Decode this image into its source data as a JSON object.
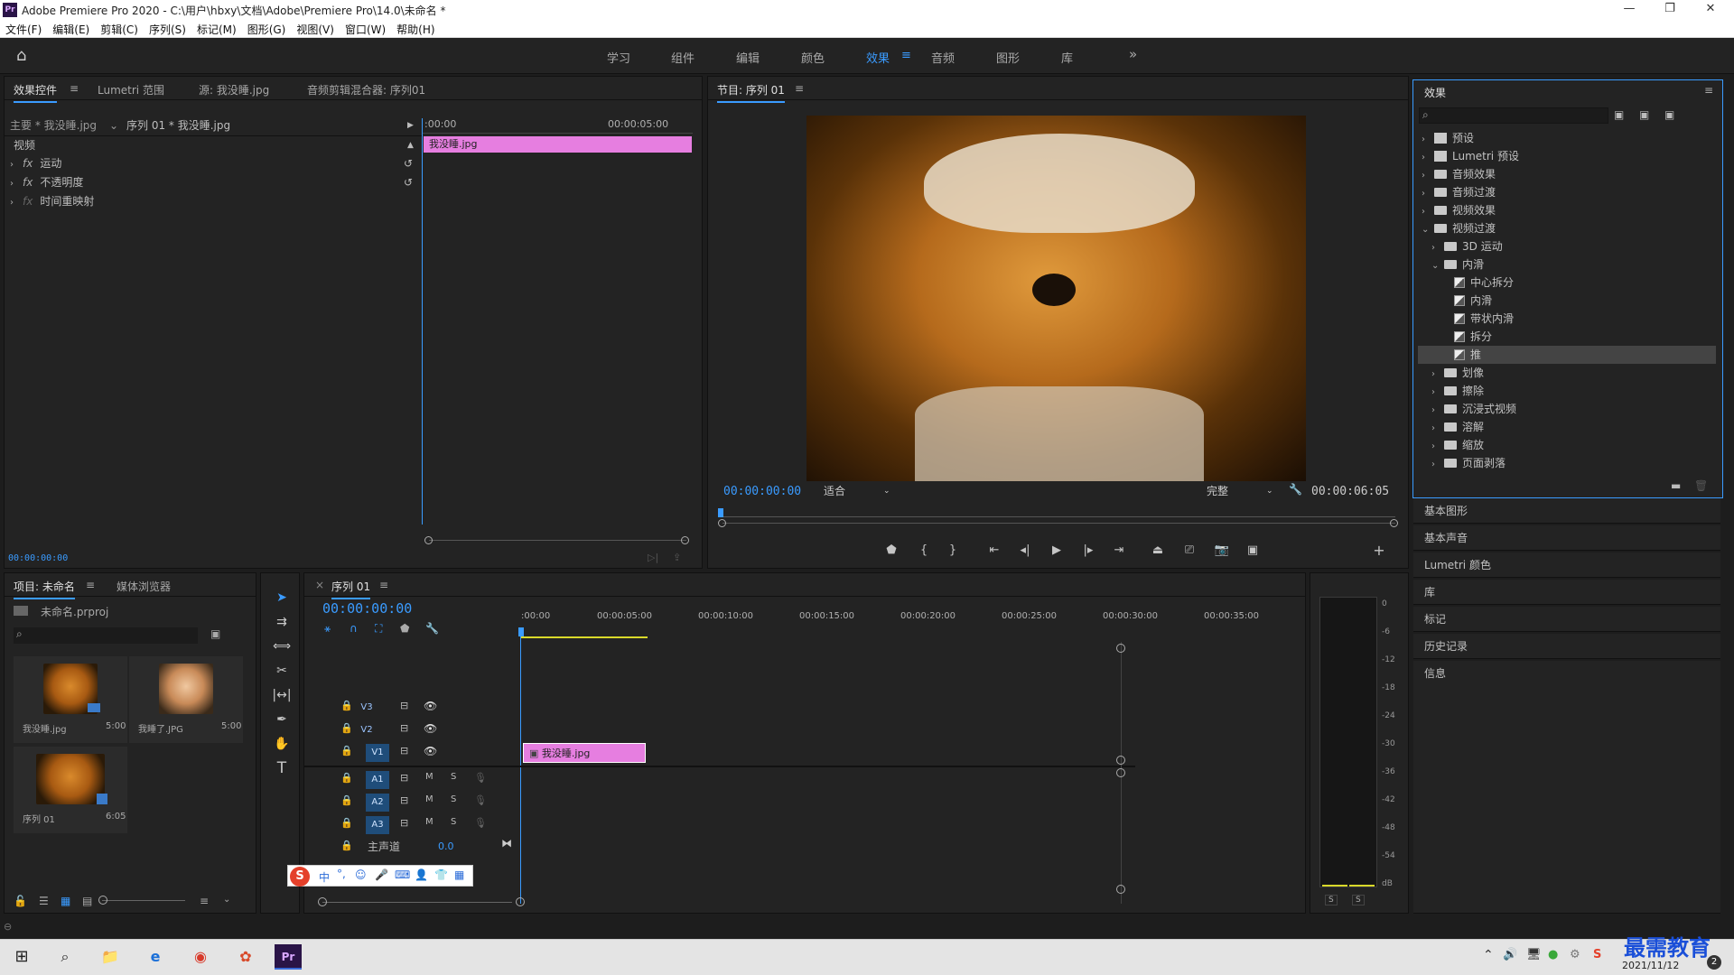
{
  "window": {
    "title": "Adobe Premiere Pro 2020 - C:\\用户\\hbxy\\文档\\Adobe\\Premiere Pro\\14.0\\未命名 *",
    "logo": "Pr"
  },
  "menu": [
    "文件(F)",
    "编辑(E)",
    "剪辑(C)",
    "序列(S)",
    "标记(M)",
    "图形(G)",
    "视图(V)",
    "窗口(W)",
    "帮助(H)"
  ],
  "workspaces": {
    "items": [
      "学习",
      "组件",
      "编辑",
      "颜色",
      "效果",
      "音频",
      "图形",
      "库"
    ],
    "active": "效果",
    "more": "»"
  },
  "effect_controls": {
    "tabs": [
      "效果控件",
      "Lumetri 范围",
      "源: 我没睡.jpg",
      "音频剪辑混合器: 序列01"
    ],
    "master": "主要 * 我没睡.jpg",
    "sequence": "序列 01 * 我没睡.jpg",
    "time_start": ":00:00",
    "time_end": "00:00:05:00",
    "clip_name": "我没睡.jpg",
    "section": "视频",
    "props": [
      {
        "fx": "fx",
        "name": "运动"
      },
      {
        "fx": "fx",
        "name": "不透明度"
      },
      {
        "fx": "fx",
        "name": "时间重映射"
      }
    ],
    "timecode": "00:00:00:00"
  },
  "program": {
    "title": "节目: 序列 01",
    "timecode": "00:00:00:00",
    "fit": "适合",
    "quality": "完整",
    "duration": "00:00:06:05"
  },
  "effects_panel": {
    "title": "效果",
    "search_placeholder": "",
    "tree": [
      {
        "label": "预设",
        "type": "preset",
        "level": 0,
        "open": false
      },
      {
        "label": "Lumetri 预设",
        "type": "preset",
        "level": 0,
        "open": false
      },
      {
        "label": "音频效果",
        "type": "folder",
        "level": 0,
        "open": false
      },
      {
        "label": "音频过渡",
        "type": "folder",
        "level": 0,
        "open": false
      },
      {
        "label": "视频效果",
        "type": "folder",
        "level": 0,
        "open": false
      },
      {
        "label": "视频过渡",
        "type": "folder",
        "level": 0,
        "open": true
      },
      {
        "label": "3D 运动",
        "type": "folder",
        "level": 1,
        "open": false
      },
      {
        "label": "内滑",
        "type": "folder",
        "level": 1,
        "open": true
      },
      {
        "label": "中心拆分",
        "type": "transition",
        "level": 2
      },
      {
        "label": "内滑",
        "type": "transition",
        "level": 2
      },
      {
        "label": "带状内滑",
        "type": "transition",
        "level": 2
      },
      {
        "label": "拆分",
        "type": "transition",
        "level": 2
      },
      {
        "label": "推",
        "type": "transition",
        "level": 2,
        "selected": true
      },
      {
        "label": "划像",
        "type": "folder",
        "level": 1,
        "open": false
      },
      {
        "label": "擦除",
        "type": "folder",
        "level": 1,
        "open": false
      },
      {
        "label": "沉浸式视频",
        "type": "folder",
        "level": 1,
        "open": false
      },
      {
        "label": "溶解",
        "type": "folder",
        "level": 1,
        "open": false
      },
      {
        "label": "缩放",
        "type": "folder",
        "level": 1,
        "open": false
      },
      {
        "label": "页面剥落",
        "type": "folder",
        "level": 1,
        "open": false
      }
    ]
  },
  "side_panels": [
    "基本图形",
    "基本声音",
    "Lumetri 颜色",
    "库",
    "标记",
    "历史记录",
    "信息"
  ],
  "project": {
    "tabs": [
      "项目: 未命名",
      "媒体浏览器"
    ],
    "file": "未命名.prproj",
    "items": [
      {
        "name": "我没睡.jpg",
        "dur": "5:00"
      },
      {
        "name": "我睡了.JPG",
        "dur": "5:00"
      },
      {
        "name": "序列 01",
        "dur": "6:05"
      }
    ]
  },
  "timeline": {
    "tab": "序列 01",
    "close": "×",
    "timecode": "00:00:00:00",
    "ruler": [
      ":00:00",
      "00:00:05:00",
      "00:00:10:00",
      "00:00:15:00",
      "00:00:20:00",
      "00:00:25:00",
      "00:00:30:00",
      "00:00:35:00"
    ],
    "video_tracks": [
      "V3",
      "V2",
      "V1"
    ],
    "audio_tracks": [
      "A1",
      "A2",
      "A3"
    ],
    "master": "主声道",
    "master_val": "0.0",
    "clip": "我没睡.jpg",
    "m": "M",
    "s": "S"
  },
  "meter": {
    "labels": [
      "0",
      "-6",
      "-12",
      "-18",
      "-24",
      "-30",
      "-36",
      "-42",
      "-48",
      "-54",
      "dB"
    ],
    "s": "S"
  },
  "ime": {
    "zh": "中",
    "punct": "°,"
  },
  "taskbar": {
    "date": "2021/11/12",
    "watermark": "最需教育",
    "badge": "2"
  }
}
